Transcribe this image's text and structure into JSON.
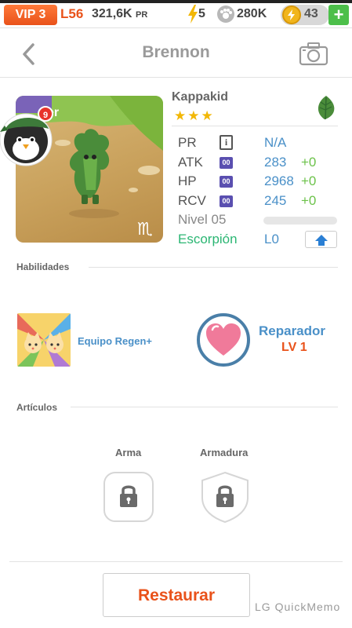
{
  "topbar": {
    "vip": "VIP 3",
    "level": "L56",
    "power_value": "321,6K",
    "power_unit": "PR",
    "energy": "5",
    "paws": "280K",
    "coins": "43",
    "plus": "+"
  },
  "header": {
    "title": "Brennon",
    "icons": {
      "back": "chevron-left-icon",
      "camera": "camera-icon"
    }
  },
  "character": {
    "name": "Kappakid",
    "stars": "★★★",
    "element_icon": "leaf-icon",
    "badge_count": "9",
    "stats": [
      {
        "label": "PR",
        "value": "N/A",
        "plus": ""
      },
      {
        "label": "ATK",
        "value": "283",
        "plus": "+0"
      },
      {
        "label": "HP",
        "value": "2968",
        "plus": "+0"
      },
      {
        "label": "RCV",
        "value": "245",
        "plus": "+0"
      }
    ],
    "stat_icon_text": "00",
    "info_icon_text": "i",
    "level_label": "Nivel 05",
    "level_progress": 0,
    "zodiac": "Escorpión",
    "zodiac_level": "L0",
    "zodiac_symbol": "♏"
  },
  "sections": {
    "skills": "Habilidades",
    "items": "Artículos"
  },
  "skills": {
    "team": "Equipo Regen+",
    "ability_name": "Reparador",
    "ability_level": "LV 1"
  },
  "equipment": {
    "weapon": "Arma",
    "armor": "Armadura"
  },
  "restore_button": "Restaurar",
  "watermark": "LG QuickMemo",
  "colors": {
    "accent_orange": "#e9521a",
    "blue": "#4a90c8",
    "green": "#6cc24a",
    "zodiac_green": "#2bb673",
    "star": "#f2b705"
  }
}
